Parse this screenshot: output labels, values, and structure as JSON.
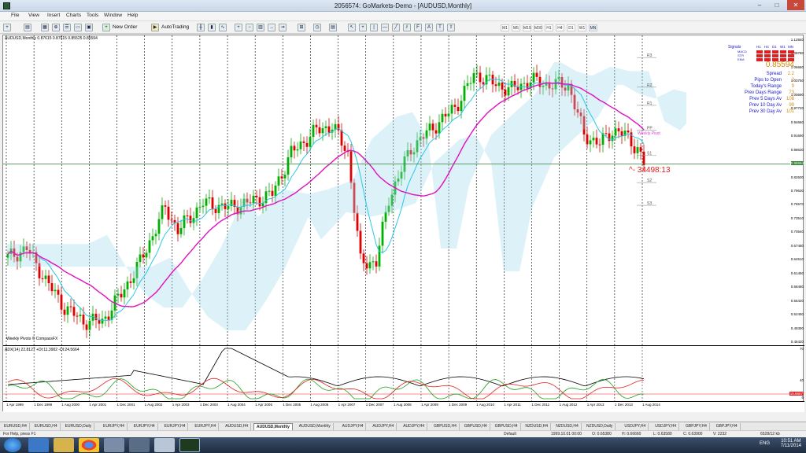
{
  "window": {
    "title": "2056574: GoMarkets-Demo - [AUDUSD,Monthly]",
    "min_label": "–",
    "max_label": "□",
    "close_label": "✕"
  },
  "menu": [
    "File",
    "View",
    "Insert",
    "Charts",
    "Tools",
    "Window",
    "Help"
  ],
  "toolbar": {
    "new_order": "New Order",
    "autotrading": "AutoTrading",
    "timeframes": [
      "M1",
      "M5",
      "M15",
      "M30",
      "H1",
      "H4",
      "D1",
      "W1",
      "MN"
    ]
  },
  "chart": {
    "header": "AUDUSD,Monthly  0.87615 0.87615 0.85525 0.85594",
    "current_price": "0.85594",
    "price_labels": [
      "1.12840",
      "1.09780",
      "1.06660",
      "1.03750",
      "1.00690",
      "0.97720",
      "0.94660",
      "0.91690",
      "0.88630",
      "0.85594",
      "0.82600",
      "0.79630",
      "0.76570",
      "0.73510",
      "0.70540",
      "0.67480",
      "0.64510",
      "0.61450",
      "0.58480",
      "0.55420",
      "0.52450",
      "0.49390",
      "0.46420"
    ],
    "pivot_labels": [
      "R3",
      "R2",
      "R1",
      "PP",
      "S1",
      "S2",
      "S3"
    ],
    "timer": "^- 34498:13",
    "pivot_text": "Weekly Pivot",
    "watermark": "Weekly Pivots © CompassFX",
    "colors": {
      "bull": "#00b000",
      "bear": "#e00000",
      "tenkan": "#28c8e8",
      "kijun": "#e010c0",
      "cloud_a": "#9fd8ee",
      "cloud_b": "#d060d0",
      "price_line": "#2e7d32"
    }
  },
  "info": {
    "signals_label": "Signals",
    "signal_tfs": [
      "H1",
      "H4",
      "D1",
      "W1",
      "MN"
    ],
    "signal_rows": [
      "MACD",
      "STR",
      "EMA"
    ],
    "price": "0.85594",
    "rows": [
      {
        "k": "Spread",
        "v": "2.2"
      },
      {
        "k": "Pips to Open",
        "v": "2"
      },
      {
        "k": "Today's Range",
        "v": "9"
      },
      {
        "k": "Prev Days Range",
        "v": "73"
      },
      {
        "k": "Prev 5 Days Av",
        "v": "108"
      },
      {
        "k": "Prev 10 Day Av",
        "v": "99"
      },
      {
        "k": "Prev 30 Day Av",
        "v": "101"
      }
    ]
  },
  "adx": {
    "header": "ADX(14) 22.8127 +DI:11.3902 -DI:24.5664",
    "levels": [
      "70",
      "40",
      "15.6667",
      "6"
    ],
    "colors": {
      "adx": "#000000",
      "plus_di": "#20a020",
      "minus_di": "#e02020"
    }
  },
  "dates": [
    "1 Apr 1999",
    "1 Dec 1999",
    "1 Aug 2000",
    "1 Apr 2001",
    "1 Dec 2001",
    "1 Aug 2002",
    "1 Apr 2003",
    "1 Dec 2003",
    "1 Aug 2004",
    "1 Apr 2005",
    "1 Dec 2005",
    "1 Aug 2006",
    "1 Apr 2007",
    "1 Dec 2007",
    "1 Aug 2008",
    "1 Apr 2009",
    "1 Dec 2009",
    "1 Aug 2010",
    "1 Apr 2011",
    "1 Dec 2011",
    "1 Aug 2012",
    "1 Apr 2013",
    "1 Dec 2013",
    "1 Aug 2014"
  ],
  "tabs": [
    "EURUSD,H4",
    "EURUSD,H4",
    "EURUSD,Daily",
    "EURJPY,H4",
    "EURJPY,H4",
    "EURJPY,H4",
    "EURJPY,H4",
    "AUDUSD,H4",
    "AUDUSD,Monthly",
    "AUDUSD,Monthly",
    "AUDJPY,H4",
    "AUDJPY,H4",
    "AUDJPY,H4",
    "GBPUSD,H4",
    "GBPUSD,H4",
    "GBPUSD,H4",
    "NZDUSD,H4",
    "NZDUSD,H4",
    "NZDUSD,Daily",
    "USDJPY,H4",
    "USDJPY,H4",
    "GBPJPY,H4",
    "GBPJPY,H4"
  ],
  "active_tab": 8,
  "status": {
    "help": "For Help, press F1",
    "profile": "Default",
    "datetime": "1999.10.01 00:00",
    "open": "O: 0.65380",
    "high": "H: 0.66660",
    "low": "L: 0.63580",
    "close": "C: 0.63900",
    "volume": "V: 2232",
    "traffic": "6528/12 kb"
  },
  "taskbar": {
    "lang": "ENG",
    "time": "10:51 AM",
    "date": "7/11/2014"
  }
}
